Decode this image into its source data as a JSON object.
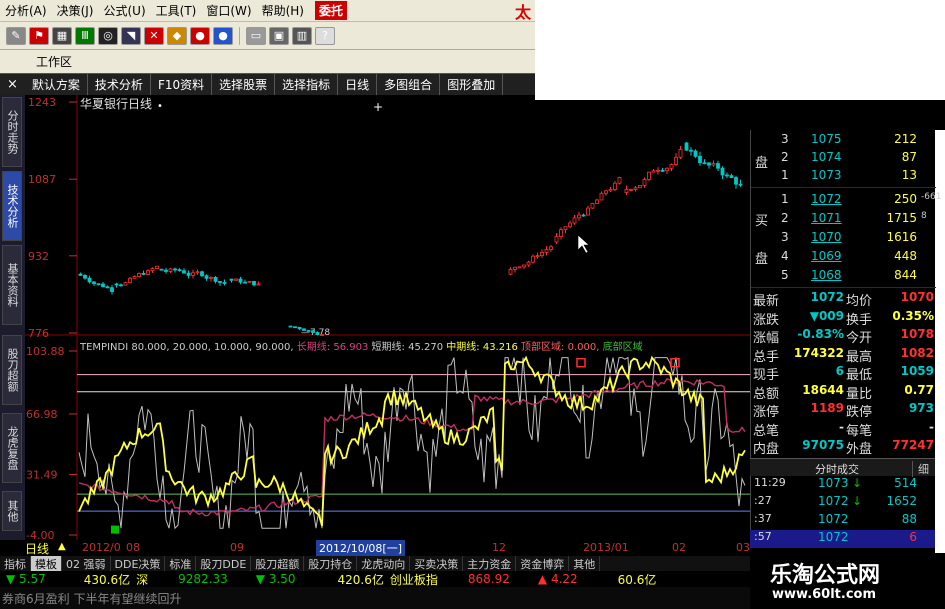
{
  "menu": {
    "items": [
      "分析(A)",
      "决策(J)",
      "公式(U)",
      "工具(T)",
      "窗口(W)",
      "帮助(H)"
    ],
    "entrust": "委托",
    "brand": "太"
  },
  "toolbar": {
    "icons": [
      "pen-icon",
      "red-flag-icon",
      "grid-icon",
      "bars-icon",
      "binoculars-icon",
      "megaphone-icon",
      "x-icon",
      "diamond-icon",
      "red-link-icon",
      "blue-link-icon",
      "note-icon",
      "window-icon",
      "books-icon",
      "help-cursor-icon"
    ],
    "colors": [
      "#888",
      "#c00",
      "#444",
      "#070",
      "#222",
      "#335",
      "#c00",
      "#c80",
      "#c00",
      "#2255cc",
      "#999",
      "#666",
      "#555",
      "#ddd"
    ]
  },
  "workspace": {
    "label": "工作区"
  },
  "funcbar": {
    "buttons": [
      "默认方案",
      "技术分析",
      "F10资料",
      "选择股票",
      "选择指标",
      "日线",
      "多图组合",
      "图形叠加"
    ],
    "close": "×"
  },
  "left_tabs": [
    "分时走势",
    "技术分析",
    "基本资料",
    "股刀超额",
    "龙虎复盘",
    "其他"
  ],
  "stock": {
    "name": "华夏银行",
    "period": "日线"
  },
  "price_axis": {
    "labels": [
      "1243",
      "1087",
      "932",
      "776"
    ],
    "values": [
      12.43,
      10.87,
      9.32,
      7.76
    ],
    "low_mark": "7 78"
  },
  "indicator": {
    "name": "TEMPINDI",
    "params": "80.000, 20.000, 10.000, 90.000,",
    "long_label": "长期线:",
    "long_value": "56.903",
    "short_label": "短期线:",
    "short_value": "45.270",
    "mid_label": "中期线:",
    "mid_value": "43.216",
    "top_label": "顶部区域:",
    "top_value": "0.000,",
    "bottom_label": "底部区域",
    "axis_labels": [
      "103.88",
      "66.98",
      "31.49",
      "-4.00"
    ]
  },
  "date_axis": {
    "period_label": "日线",
    "labels": [
      "2012/0",
      "08",
      "09",
      "12",
      "2013/01",
      "02",
      "03"
    ],
    "cursor_date": "2012/10/08[一]"
  },
  "indicator_tabs": [
    "指标",
    "模板",
    "02 强弱",
    "DDE决策",
    "标准",
    "股刀DDE",
    "股刀超额",
    "股刀持仓",
    "龙虎动向",
    "买卖决策",
    "主力资金",
    "资金博弈",
    "其他"
  ],
  "index_bar": {
    "sh_change": "5.57",
    "sh_amount": "430.6亿",
    "sz_label": "深",
    "sz_value": "9282.33",
    "sz_change": "3.50",
    "sz_amount": "420.6亿",
    "cyb_label": "创业板指",
    "cyb_value": "868.92",
    "cyb_change": "4.22",
    "cyb_amount": "60.6亿"
  },
  "news": {
    "text": "券商6月盈利  下半年有望继续回升"
  },
  "quote": {
    "sell_label": "盘",
    "buy_label_1": "买",
    "buy_label_2": "盘",
    "sell_rows": [
      {
        "level": "3",
        "price": "1075",
        "volume": "212"
      },
      {
        "level": "2",
        "price": "1074",
        "volume": "87"
      },
      {
        "level": "1",
        "price": "1073",
        "volume": "13"
      }
    ],
    "buy_rows": [
      {
        "level": "1",
        "price": "1072",
        "volume": "250",
        "extra": "-661"
      },
      {
        "level": "2",
        "price": "1071",
        "volume": "1715",
        "extra": "8"
      },
      {
        "level": "3",
        "price": "1070",
        "volume": "1616",
        "extra": ""
      },
      {
        "level": "4",
        "price": "1069",
        "volume": "448",
        "extra": ""
      },
      {
        "level": "5",
        "price": "1068",
        "volume": "844",
        "extra": ""
      }
    ],
    "stats": [
      {
        "l1": "最新",
        "v1": "1072",
        "l2": "均价",
        "v2": "1070"
      },
      {
        "l1": "涨跌",
        "v1": "▼009",
        "l2": "换手",
        "v2": "0.35%"
      },
      {
        "l1": "涨幅",
        "v1": "-0.83%",
        "l2": "今开",
        "v2": "1078"
      },
      {
        "l1": "总手",
        "v1": "174322",
        "l2": "最高",
        "v2": "1082"
      },
      {
        "l1": "现手",
        "v1": "6",
        "l2": "最低",
        "v2": "1059"
      },
      {
        "l1": "总额",
        "v1": "18644",
        "l2": "量比",
        "v2": "0.77"
      },
      {
        "l1": "涨停",
        "v1": "1189",
        "l2": "跌停",
        "v2": "973"
      },
      {
        "l1": "总笔",
        "v1": "-",
        "l2": "每笔",
        "v2": "-"
      },
      {
        "l1": "内盘",
        "v1": "97075",
        "l2": "外盘",
        "v2": "77247"
      }
    ],
    "trade_header": "分时成交",
    "trade_tab": "细",
    "trades": [
      {
        "time": "11:29",
        "price": "1073",
        "dir": "↓",
        "vol": "514"
      },
      {
        "time": ":27",
        "price": "1072",
        "dir": "↓",
        "vol": "1652"
      },
      {
        "time": ":37",
        "price": "1072",
        "dir": "",
        "vol": "88"
      },
      {
        "time": ":57",
        "price": "1072",
        "dir": "",
        "vol": "6"
      }
    ]
  },
  "watermark": {
    "title": "乐淘公式网",
    "url": "www.60lt.com"
  },
  "colors": {
    "up": "#ff3030",
    "down": "#00c8c8",
    "yellow_line": "#ffff40",
    "magenta_line": "#c03060",
    "gray_line": "#c0c0c0",
    "axis_red": "#c03030",
    "green": "#00c000"
  }
}
